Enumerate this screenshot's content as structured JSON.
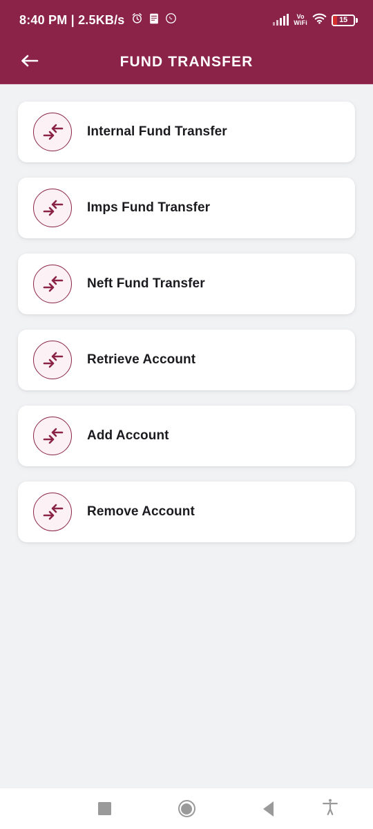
{
  "status_bar": {
    "clock": "8:40 PM | 2.5KB/s",
    "icons_left": [
      "alarm-icon",
      "notes-icon",
      "whatsapp-icon"
    ],
    "network_label": "Vo",
    "network_label2": "WiFi",
    "battery_percent": "15",
    "icons_right": [
      "signal-icon",
      "volte-wifi-icon",
      "wifi-icon",
      "battery-icon"
    ]
  },
  "header": {
    "title": "FUND TRANSFER",
    "back_icon": "back-arrow-icon",
    "color": "#8a2347"
  },
  "theme": {
    "accent": "#8a2347",
    "page_background": "#f1f2f4",
    "card_background": "#ffffff",
    "icon_circle_fill": "#fcf2f5",
    "label_color": "#1b1b1f",
    "battery_fill": "#d32f2f"
  },
  "menu": {
    "items": [
      {
        "label": "Internal Fund Transfer",
        "icon": "fund-transfer-icon"
      },
      {
        "label": "Imps Fund Transfer",
        "icon": "fund-transfer-icon"
      },
      {
        "label": "Neft Fund Transfer",
        "icon": "fund-transfer-icon"
      },
      {
        "label": "Retrieve Account",
        "icon": "fund-transfer-icon"
      },
      {
        "label": "Add Account",
        "icon": "fund-transfer-icon"
      },
      {
        "label": "Remove Account",
        "icon": "fund-transfer-icon"
      }
    ]
  },
  "nav_bar": {
    "recents": "recents-square-icon",
    "home": "home-circle-icon",
    "back": "back-triangle-icon",
    "accessibility": "accessibility-icon"
  }
}
